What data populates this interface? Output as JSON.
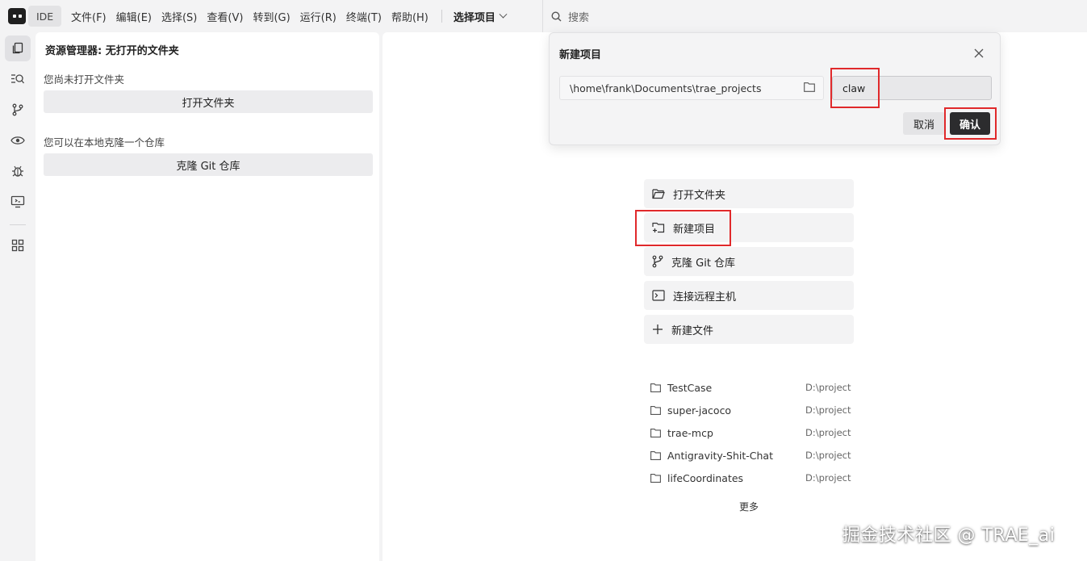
{
  "topbar": {
    "ide_badge": "IDE",
    "menu": [
      "文件(F)",
      "编辑(E)",
      "选择(S)",
      "查看(V)",
      "转到(G)",
      "运行(R)",
      "终端(T)",
      "帮助(H)"
    ],
    "project_select": "选择项目",
    "search_placeholder": "搜索"
  },
  "explorer": {
    "title": "资源管理器: 无打开的文件夹",
    "no_folder_text": "您尚未打开文件夹",
    "open_folder_btn": "打开文件夹",
    "clone_text": "您可以在本地克隆一个仓库",
    "clone_btn": "克隆 Git 仓库"
  },
  "dialog": {
    "title": "新建项目",
    "path": "\\home\\frank\\Documents\\trae_projects",
    "name_value": "claw",
    "cancel": "取消",
    "confirm": "确认"
  },
  "start": {
    "items": [
      {
        "label": "打开文件夹",
        "icon": "folder-open-icon"
      },
      {
        "label": "新建项目",
        "icon": "new-project-icon"
      },
      {
        "label": "克隆 Git 仓库",
        "icon": "git-branch-icon"
      },
      {
        "label": "连接远程主机",
        "icon": "terminal-icon"
      },
      {
        "label": "新建文件",
        "icon": "plus-icon"
      }
    ],
    "recent": [
      {
        "name": "TestCase",
        "path": "D:\\project"
      },
      {
        "name": "super-jacoco",
        "path": "D:\\project"
      },
      {
        "name": "trae-mcp",
        "path": "D:\\project"
      },
      {
        "name": "Antigravity-Shit-Chat",
        "path": "D:\\project"
      },
      {
        "name": "lifeCoordinates",
        "path": "D:\\project"
      }
    ],
    "more": "更多"
  },
  "watermark": "掘金技术社区 @ TRAE_ai",
  "colors": {
    "annotation_red": "#e0292b",
    "confirm_bg": "#2c2c2e"
  }
}
